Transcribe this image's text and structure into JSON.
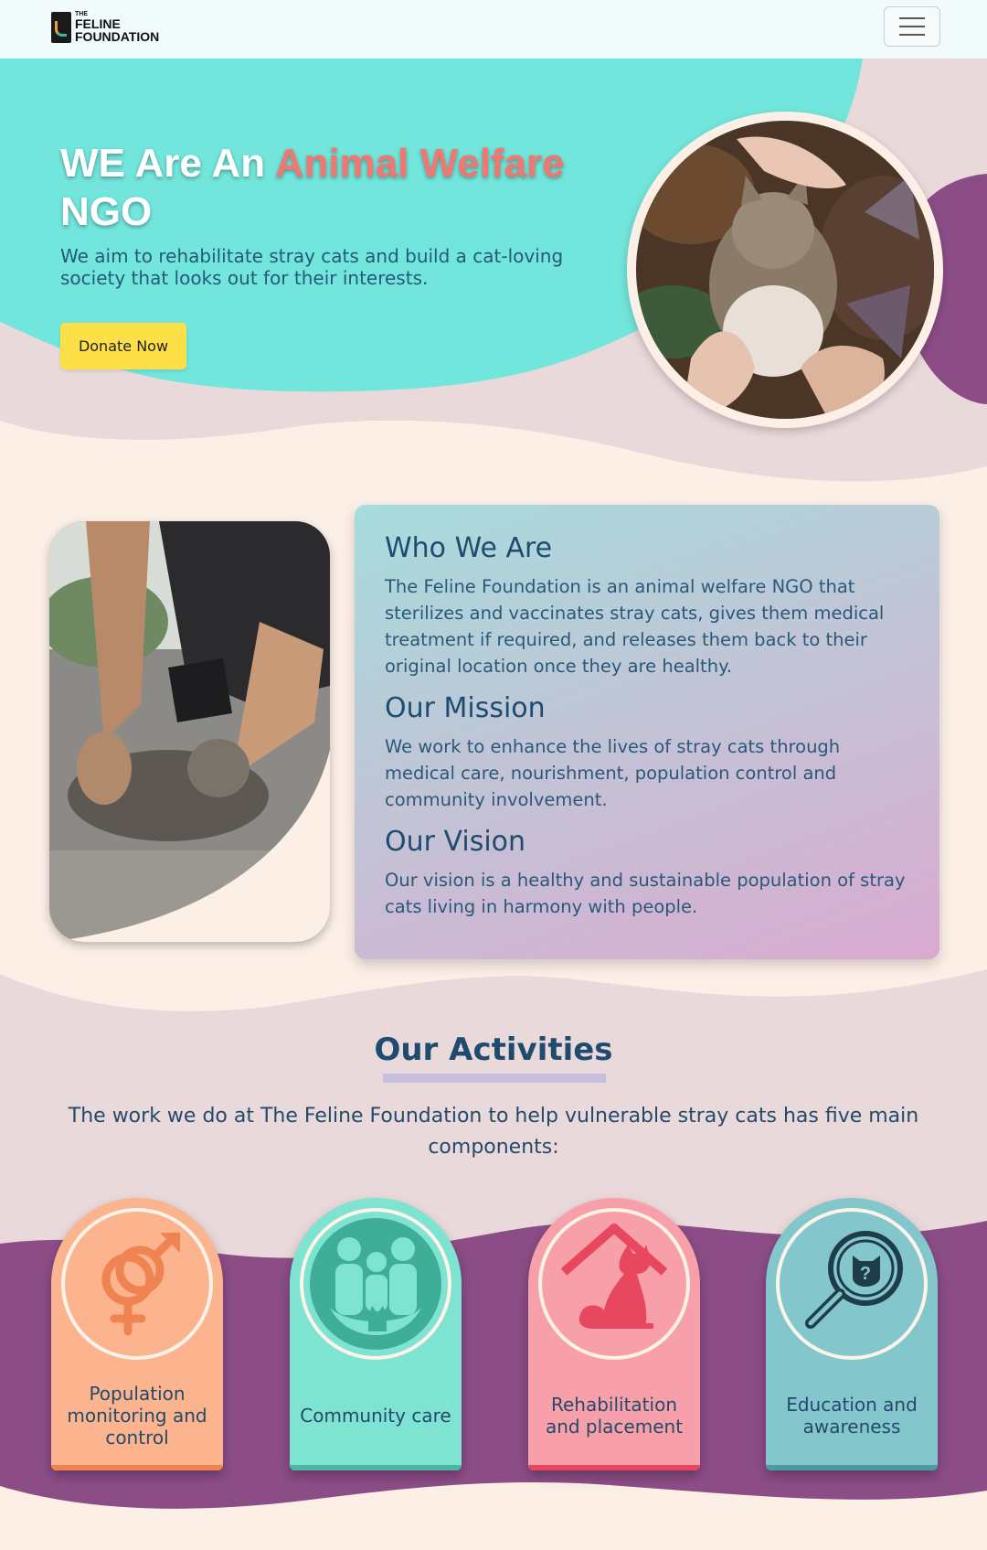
{
  "nav": {
    "logo_the": "THE",
    "logo_feline": "FELINE",
    "logo_foundation": "FOUNDATION"
  },
  "hero": {
    "title_prefix": "WE Are An ",
    "title_highlight": "Animal Welfare",
    "title_suffix": " NGO",
    "subtitle": "We aim to rehabilitate stray cats and build a cat-loving society that looks out for their interests.",
    "donate_label": "Donate Now"
  },
  "about": {
    "who_title": "Who We Are",
    "who_text": "The Feline Foundation is an animal welfare NGO that sterilizes and vaccinates stray cats, gives them medical treatment if required, and releases them back to their original location once they are healthy.",
    "mission_title": "Our Mission",
    "mission_text": "We work to enhance the lives of stray cats through medical care, nourishment, population control and community involvement.",
    "vision_title": "Our Vision",
    "vision_text": "Our vision is a healthy and sustainable population of stray cats living in harmony with people."
  },
  "activities": {
    "title": "Our Activities",
    "subtitle": "The work we do at The Feline Foundation to help vulnerable stray cats has five main components:",
    "cards": [
      {
        "label": "Population monitoring and control",
        "icon": "gender-symbols-icon"
      },
      {
        "label": "Community care",
        "icon": "family-cat-icon"
      },
      {
        "label": "Rehabilitation and placement",
        "icon": "cat-house-icon"
      },
      {
        "label": "Education and awareness",
        "icon": "magnifier-question-icon"
      }
    ]
  },
  "colors": {
    "turquoise": "#72e6dc",
    "purple": "#8c4d87",
    "cream": "#fcefe6",
    "blush": "#ead9da",
    "donate": "#fde047",
    "highlight": "#f07870",
    "heading": "#1f4c6e"
  }
}
